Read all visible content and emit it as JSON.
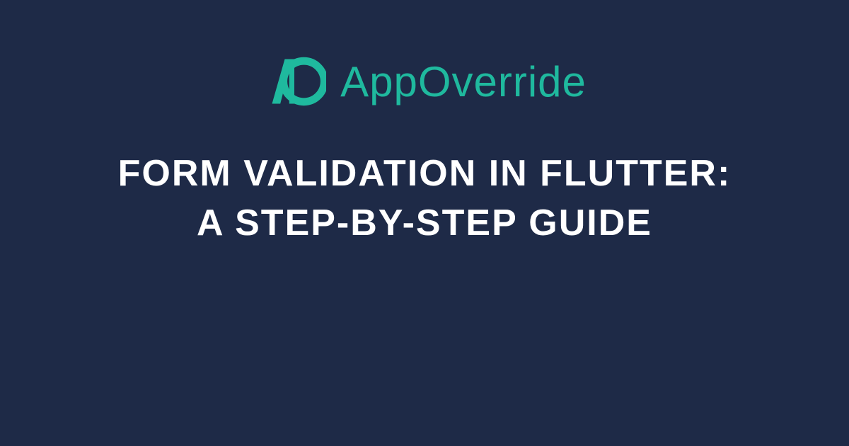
{
  "brand": {
    "name": "AppOverride",
    "logo_color": "#1fb99e"
  },
  "title": "Form Validation in Flutter: A Step-by-Step Guide",
  "colors": {
    "background": "#1e2a47",
    "accent": "#1fb99e",
    "text": "#ffffff"
  }
}
